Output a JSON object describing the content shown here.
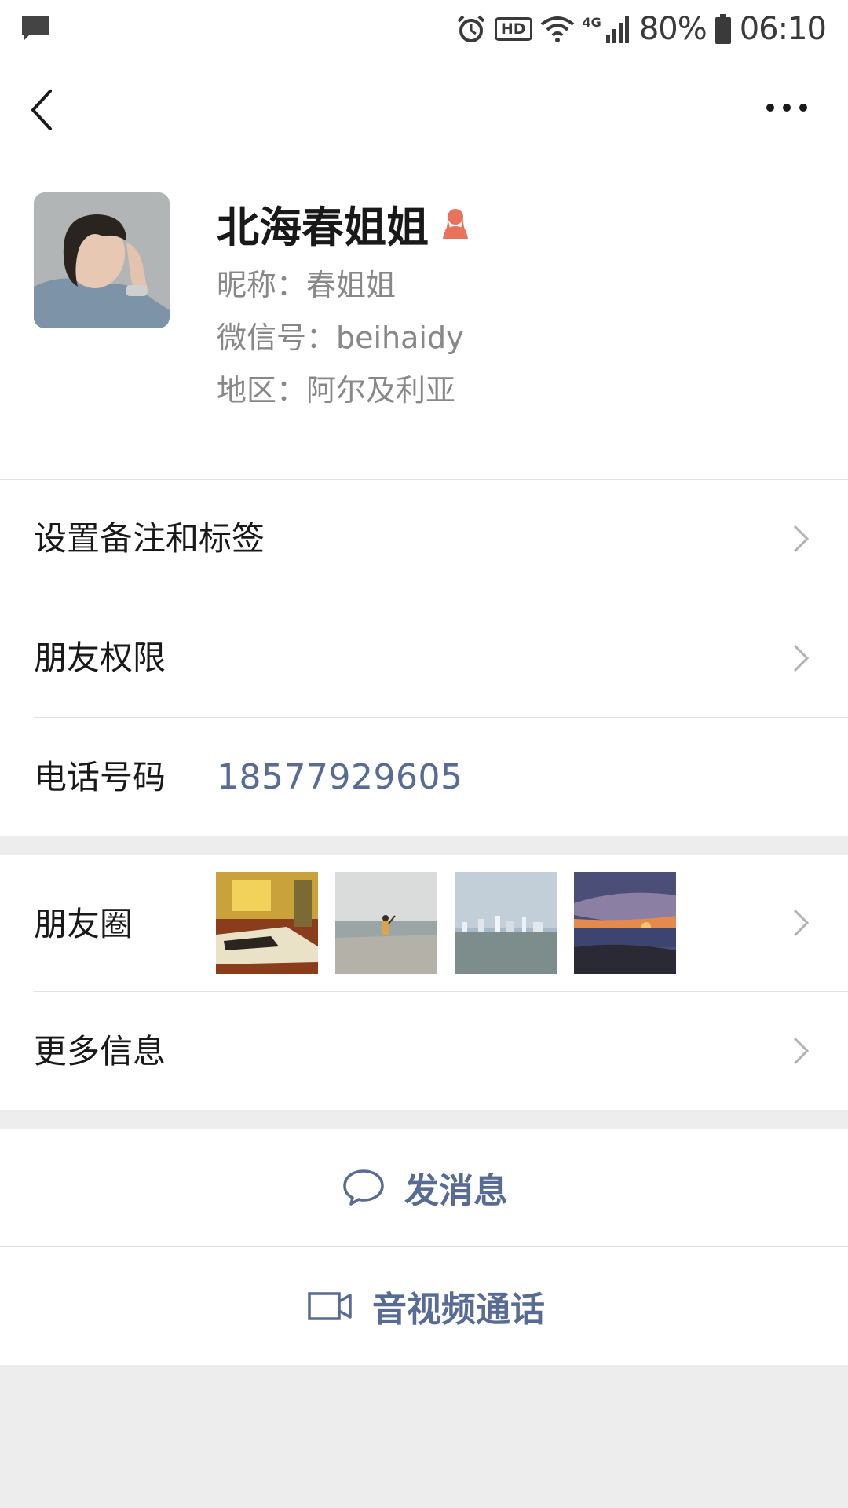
{
  "status_bar": {
    "battery": "80%",
    "time": "06:10",
    "hd_badge": "HD",
    "network": "4G"
  },
  "profile": {
    "name": "北海春姐姐",
    "nickname": "昵称：春姐姐",
    "wechat_id": "微信号：beihaidy",
    "region": "地区：阿尔及利亚"
  },
  "menu": {
    "remark_tags": "设置备注和标签",
    "permissions": "朋友权限",
    "phone_label": "电话号码",
    "phone_value": "18577929605",
    "moments_label": "朋友圈",
    "more_info": "更多信息"
  },
  "actions": {
    "send_message": "发消息",
    "video_call": "音视频通话"
  },
  "icons": {
    "back": "chevron-left-icon",
    "more": "more-dots-icon",
    "gender": "female-icon",
    "message": "chat-bubble-icon",
    "video": "video-camera-icon"
  },
  "colors": {
    "link_blue": "#576b95",
    "gender_female": "#e9735a"
  }
}
